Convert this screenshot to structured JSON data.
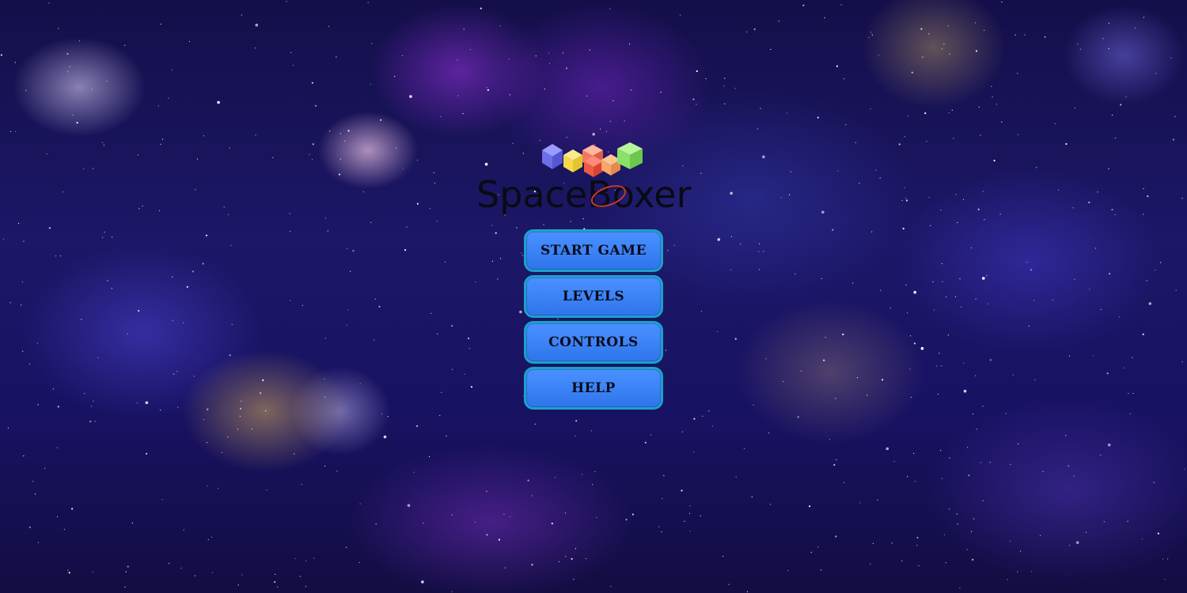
{
  "logo": {
    "text": "SpaceBoxer",
    "cube_colors": [
      "#7b7cf2",
      "#f5d94a",
      "#f07a5e",
      "#f9a56b",
      "#ee7f58",
      "#8be06a"
    ]
  },
  "menu": {
    "start_game": "START GAME",
    "levels": "LEVELS",
    "controls": "CONTROLS",
    "help": "HELP"
  },
  "colors": {
    "button_fill": "#3b82f6",
    "button_border": "#1aa3c8",
    "button_text": "#0b0b1a"
  }
}
